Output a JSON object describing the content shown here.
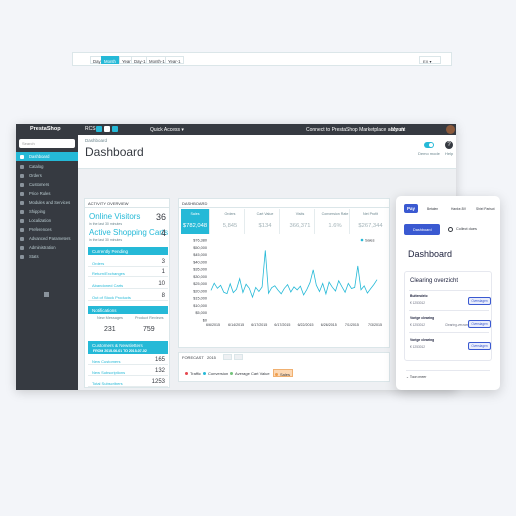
{
  "topbar": {
    "logo": "PrestaShop",
    "quick_access_logo": "RCS",
    "quick_access": "Quick Access ▾",
    "connect": "Connect to PrestaShop Marketplace account",
    "shop": "My sh"
  },
  "sidebar": {
    "search_placeholder": "Search",
    "items": [
      {
        "label": "Dashboard",
        "icon": "dashboard-icon"
      },
      {
        "label": "Catalog",
        "icon": "catalog-icon"
      },
      {
        "label": "Orders",
        "icon": "orders-icon"
      },
      {
        "label": "Customers",
        "icon": "customers-icon"
      },
      {
        "label": "Price Rules",
        "icon": "price-rules-icon"
      },
      {
        "label": "Modules and Services",
        "icon": "modules-icon"
      },
      {
        "label": "Shipping",
        "icon": "shipping-icon"
      },
      {
        "label": "Localization",
        "icon": "localization-icon"
      },
      {
        "label": "Preferences",
        "icon": "preferences-icon"
      },
      {
        "label": "Advanced Parameters",
        "icon": "advanced-icon"
      },
      {
        "label": "Administration",
        "icon": "administration-icon"
      },
      {
        "label": "Stats",
        "icon": "stats-icon"
      }
    ]
  },
  "header": {
    "breadcrumb": "Dashboard",
    "title": "Dashboard",
    "demo_mode": "Demo mode",
    "help": "Help"
  },
  "range": {
    "buttons": [
      "Day",
      "Month",
      "Year",
      "Day-1",
      "Month-1",
      "Year-1"
    ],
    "active": "Month",
    "select": "EX ▾"
  },
  "activity": {
    "title": "ACTIVITY OVERVIEW",
    "online_label": "Online Visitors",
    "online_value": "36",
    "online_sub": "in the last 30 minutes",
    "carts_label": "Active Shopping Carts",
    "carts_value": "4",
    "carts_sub": "in the last 30 minutes",
    "pending_title": "Currently Pending",
    "pending_rows": [
      {
        "label": "Orders",
        "value": "3"
      },
      {
        "label": "Return/Exchanges",
        "value": "1"
      },
      {
        "label": "Abandoned Carts",
        "value": "10"
      },
      {
        "label": "Out of Stock Products",
        "value": "8"
      }
    ],
    "notifications_title": "Notifications",
    "new_messages_label": "New Messages",
    "new_messages_value": "231",
    "product_reviews_label": "Product Reviews",
    "product_reviews_value": "759",
    "customers_title": "Customers & Newsletters",
    "customers_sub": "FROM 2015-06-01 TO 2015-07-02",
    "customer_rows": [
      {
        "label": "New Customers",
        "value": "165"
      },
      {
        "label": "New Subscriptions",
        "value": "132"
      },
      {
        "label": "Total Subscribers",
        "value": "1253"
      }
    ]
  },
  "dashboard": {
    "title": "DASHBOARD",
    "kpis": [
      {
        "label": "Sales",
        "value": "$782,048"
      },
      {
        "label": "Orders",
        "value": "5,845"
      },
      {
        "label": "Cart Value",
        "value": "$134"
      },
      {
        "label": "Visits",
        "value": "366,371"
      },
      {
        "label": "Conversion Rate",
        "value": "1.6%"
      },
      {
        "label": "Net Profit",
        "value": "$267,344"
      }
    ]
  },
  "chart_data": {
    "type": "line",
    "series": [
      {
        "name": "Sales",
        "color": "#25b9d7",
        "values": [
          18500,
          23000,
          19800,
          21700,
          17300,
          16500,
          22700,
          17100,
          19200,
          25800,
          17200,
          22400,
          19800,
          14300,
          20400,
          17800,
          20600,
          43500,
          16700,
          20200,
          21400,
          18700,
          16400,
          19800,
          22100,
          17500,
          20700,
          18800,
          21200,
          15700,
          19000,
          23400,
          31400,
          21800,
          17800,
          22800,
          16300,
          23700,
          20500,
          18100,
          24500,
          20800,
          17300,
          22900,
          19700,
          20400,
          33800,
          18900,
          21300,
          16800,
          19500,
          22100,
          25200
        ]
      }
    ],
    "yticks": [
      "$76,380",
      "$50,000",
      "$45,000",
      "$40,000",
      "$35,000",
      "$30,000",
      "$25,000",
      "$20,000",
      "$15,000",
      "$10,000",
      "$5,000",
      "$0"
    ],
    "xticks": [
      "6/6/2015",
      "6/14/2015",
      "6/17/2015",
      "6/17/2015",
      "6/22/2015",
      "6/26/2015",
      "7/1/2015",
      "7/3/2015"
    ],
    "ylim": [
      0,
      50000
    ],
    "legend": "top-right"
  },
  "forecast": {
    "title": "FORECAST",
    "year": "2015",
    "legend": [
      {
        "label": "Traffic",
        "color": "#e5474f"
      },
      {
        "label": "Conversion",
        "color": "#25b9d7"
      },
      {
        "label": "Average Cart Value",
        "color": "#72c279"
      },
      {
        "label": "Sales",
        "color": "#f0a050"
      }
    ]
  },
  "pay": {
    "logo": "Pay",
    "nav": [
      "Betalen",
      "Hanke-BV",
      "Shiel Parisot"
    ],
    "tab_active": "Dashboard",
    "tab_other": "Collect dues",
    "heading": "Dashboard",
    "card_title": "Clearing overzicht",
    "rows": [
      {
        "label": "Buitendelo",
        "amount": "€ 1253012",
        "desc": "",
        "button": "Overslagen"
      },
      {
        "label": "Vorige clearing",
        "amount": "€ 1253012",
        "desc": "Clearing-verzameld",
        "button": "Overslagen"
      },
      {
        "label": "Vorige clearing",
        "amount": "€ 1253012",
        "desc": "",
        "button": "Overslagen"
      }
    ],
    "more": "Toon meer"
  },
  "colors": {
    "accent": "#25b9d7",
    "dark": "#363a41",
    "pay_blue": "#3a59d1"
  }
}
